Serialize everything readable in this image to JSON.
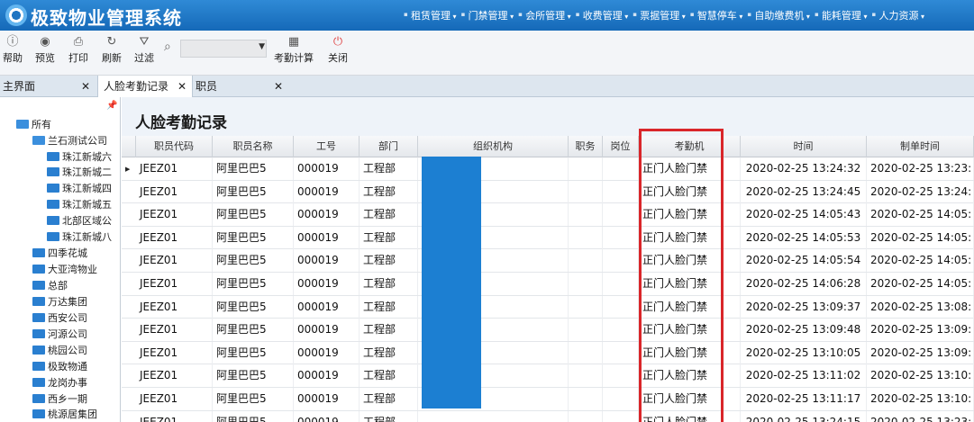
{
  "app": {
    "title": "极致物业管理系统"
  },
  "top_menu": [
    "租赁管理",
    "门禁管理",
    "会所管理",
    "收费管理",
    "票据管理",
    "智慧停车",
    "自助缴费机",
    "能耗管理",
    "人力资源"
  ],
  "toolbar": {
    "help": "帮助",
    "preview": "预览",
    "print": "打印",
    "refresh": "刷新",
    "filter": "过滤",
    "attendance_calc": "考勤计算",
    "close": "关闭"
  },
  "tabs": [
    {
      "label": "主界面"
    },
    {
      "label": "人脸考勤记录"
    },
    {
      "label": "职员"
    }
  ],
  "tree": [
    "所有",
    "兰石测试公司",
    "珠江新城六",
    "珠江新城二",
    "珠江新城四",
    "珠江新城五",
    "北部区域公",
    "珠江新城八",
    "四季花城",
    "大亚湾物业",
    "总部",
    "万达集团",
    "西安公司",
    "河源公司",
    "桃园公司",
    "极致物通",
    "龙岗办事",
    "西乡一期",
    "桃源居集团"
  ],
  "page_title": "人脸考勤记录",
  "columns": [
    "职员代码",
    "职员名称",
    "工号",
    "部门",
    "组织机构",
    "职务",
    "岗位",
    "考勤机",
    "时间",
    "制单时间"
  ],
  "rows": [
    {
      "code": "JEEZ01",
      "name": "阿里巴巴5",
      "no": "000019",
      "dept": "工程部",
      "machine": "正门人脸门禁",
      "time": "2020-02-25 13:24:32",
      "created": "2020-02-25 13:23:"
    },
    {
      "code": "JEEZ01",
      "name": "阿里巴巴5",
      "no": "000019",
      "dept": "工程部",
      "machine": "正门人脸门禁",
      "time": "2020-02-25 13:24:45",
      "created": "2020-02-25 13:24:"
    },
    {
      "code": "JEEZ01",
      "name": "阿里巴巴5",
      "no": "000019",
      "dept": "工程部",
      "machine": "正门人脸门禁",
      "time": "2020-02-25 14:05:43",
      "created": "2020-02-25 14:05:"
    },
    {
      "code": "JEEZ01",
      "name": "阿里巴巴5",
      "no": "000019",
      "dept": "工程部",
      "machine": "正门人脸门禁",
      "time": "2020-02-25 14:05:53",
      "created": "2020-02-25 14:05:"
    },
    {
      "code": "JEEZ01",
      "name": "阿里巴巴5",
      "no": "000019",
      "dept": "工程部",
      "machine": "正门人脸门禁",
      "time": "2020-02-25 14:05:54",
      "created": "2020-02-25 14:05:"
    },
    {
      "code": "JEEZ01",
      "name": "阿里巴巴5",
      "no": "000019",
      "dept": "工程部",
      "machine": "正门人脸门禁",
      "time": "2020-02-25 14:06:28",
      "created": "2020-02-25 14:05:"
    },
    {
      "code": "JEEZ01",
      "name": "阿里巴巴5",
      "no": "000019",
      "dept": "工程部",
      "machine": "正门人脸门禁",
      "time": "2020-02-25 13:09:37",
      "created": "2020-02-25 13:08:"
    },
    {
      "code": "JEEZ01",
      "name": "阿里巴巴5",
      "no": "000019",
      "dept": "工程部",
      "machine": "正门人脸门禁",
      "time": "2020-02-25 13:09:48",
      "created": "2020-02-25 13:09:"
    },
    {
      "code": "JEEZ01",
      "name": "阿里巴巴5",
      "no": "000019",
      "dept": "工程部",
      "machine": "正门人脸门禁",
      "time": "2020-02-25 13:10:05",
      "created": "2020-02-25 13:09:"
    },
    {
      "code": "JEEZ01",
      "name": "阿里巴巴5",
      "no": "000019",
      "dept": "工程部",
      "machine": "正门人脸门禁",
      "time": "2020-02-25 13:11:02",
      "created": "2020-02-25 13:10:"
    },
    {
      "code": "JEEZ01",
      "name": "阿里巴巴5",
      "no": "000019",
      "dept": "工程部",
      "machine": "正门人脸门禁",
      "time": "2020-02-25 13:11:17",
      "created": "2020-02-25 13:10:"
    },
    {
      "code": "JEEZ01",
      "name": "阿里巴巴5",
      "no": "000019",
      "dept": "工程部",
      "machine": "正门人脸门禁",
      "time": "2020-02-25 13:24:15",
      "created": "2020-02-25 13:23:"
    }
  ],
  "colors": {
    "header": "#1a6fbf",
    "highlight": "#d9262a",
    "redacted": "#1c7fd2"
  }
}
